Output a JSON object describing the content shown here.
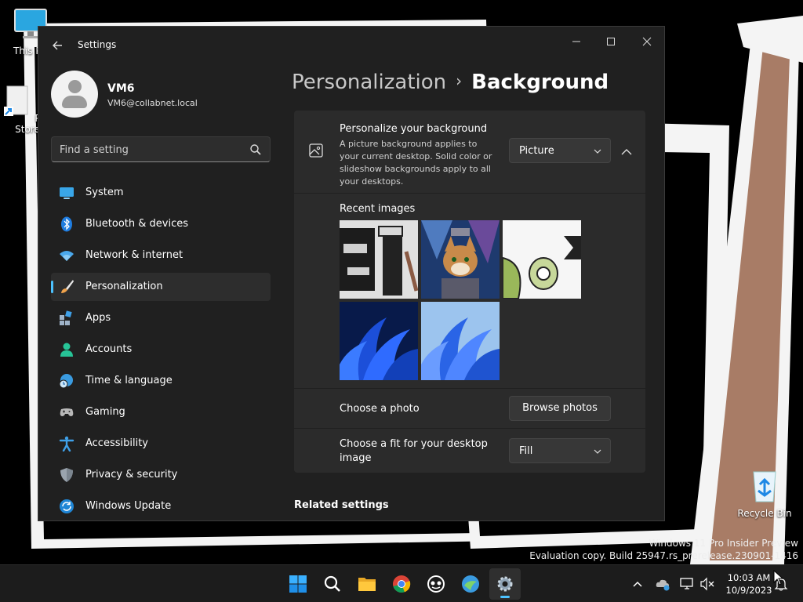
{
  "desktop": {
    "icons": [
      {
        "label": "This PC"
      },
      {
        "label": "Play Store"
      },
      {
        "label": "Recycle Bin"
      }
    ],
    "watermark_line1": "Windows 11 Pro Insider Preview",
    "watermark_line2": "Evaluation copy. Build 25947.rs_prerelease.230901-1416"
  },
  "window": {
    "title": "Settings",
    "controls": [
      "minimize",
      "maximize",
      "close"
    ]
  },
  "user": {
    "name": "VM6",
    "email": "VM6@collabnet.local"
  },
  "search": {
    "placeholder": "Find a setting"
  },
  "sidebar": {
    "items": [
      {
        "label": "System",
        "icon": "system-icon"
      },
      {
        "label": "Bluetooth & devices",
        "icon": "bluetooth-icon"
      },
      {
        "label": "Network & internet",
        "icon": "wifi-icon"
      },
      {
        "label": "Personalization",
        "icon": "brush-icon",
        "active": true
      },
      {
        "label": "Apps",
        "icon": "apps-icon"
      },
      {
        "label": "Accounts",
        "icon": "accounts-icon"
      },
      {
        "label": "Time & language",
        "icon": "globe-clock-icon"
      },
      {
        "label": "Gaming",
        "icon": "gamepad-icon"
      },
      {
        "label": "Accessibility",
        "icon": "accessibility-icon"
      },
      {
        "label": "Privacy & security",
        "icon": "shield-icon"
      },
      {
        "label": "Windows Update",
        "icon": "update-icon"
      }
    ]
  },
  "breadcrumb": {
    "parent": "Personalization",
    "separator": "›",
    "current": "Background"
  },
  "background": {
    "title": "Personalize your background",
    "description": "A picture background applies to your current desktop. Solid color or slideshow backgrounds apply to all your desktops.",
    "type_value": "Picture",
    "recent_title": "Recent images",
    "recent_images": [
      {
        "name": "cartoon-image"
      },
      {
        "name": "game-character-image"
      },
      {
        "name": "green-eye-image"
      },
      {
        "name": "windows-bloom-dark-image"
      },
      {
        "name": "windows-bloom-light-image"
      }
    ],
    "choose_photo_label": "Choose a photo",
    "browse_button": "Browse photos",
    "fit_label_line1": "Choose a fit for your desktop",
    "fit_label_line2": "image",
    "fit_value": "Fill"
  },
  "related_settings": "Related settings",
  "taskbar": {
    "apps": [
      "start-icon",
      "search-icon",
      "file-explorer-icon",
      "chrome-icon",
      "app-icon",
      "app-icon-2",
      "settings-icon"
    ],
    "time": "10:03 AM",
    "date": "10/9/2023"
  },
  "colors": {
    "accent": "#4cc2ff",
    "window_bg": "#202020",
    "card_bg": "#2b2b2b"
  }
}
